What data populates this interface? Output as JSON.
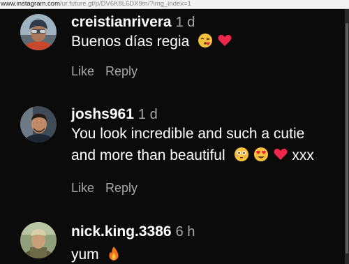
{
  "browser": {
    "url_host": "www.instagram.com",
    "url_path": "/ur.future.gf/p/DV6K8L6DX9m/?img_index=1"
  },
  "comments": [
    {
      "username": "creistianrivera",
      "time": "1 d",
      "text": "Buenos días regia",
      "emojis": [
        "face-blowing-kiss-emoji",
        "red-heart-emoji"
      ],
      "like_label": "Like",
      "reply_label": "Reply"
    },
    {
      "username": "joshs961",
      "time": "1 d",
      "text_line1": "You look incredible and such a cutie",
      "text_line2": "and more than beautiful",
      "emojis": [
        "flushed-face-emoji",
        "heart-eyes-emoji",
        "red-heart-emoji"
      ],
      "text_tail": "xxx",
      "like_label": "Like",
      "reply_label": "Reply"
    },
    {
      "username": "nick.king.3386",
      "time": "6 h",
      "text": "yum",
      "emojis": [
        "fire-emoji"
      ]
    }
  ],
  "colors": {
    "background": "#0b0b0b",
    "username": "#ffffff",
    "secondary_text": "#a8a8a8"
  }
}
